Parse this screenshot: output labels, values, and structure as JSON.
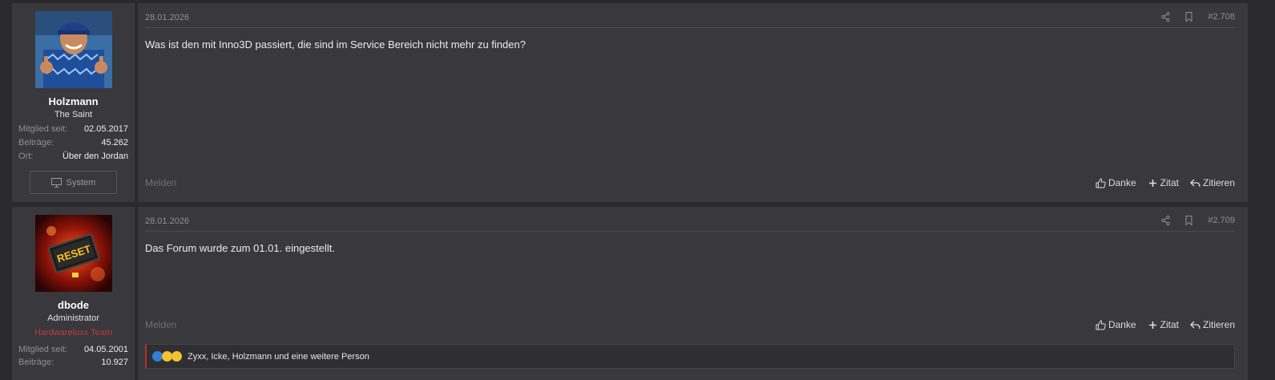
{
  "posts": [
    {
      "user": {
        "name": "Holzmann",
        "title": "The Saint",
        "banner": "",
        "stats": [
          {
            "label": "Mitglied seit:",
            "value": "02.05.2017"
          },
          {
            "label": "Beiträge:",
            "value": "45.262"
          },
          {
            "label": "Ort:",
            "value": "Über den Jordan"
          }
        ],
        "system_button": "System"
      },
      "date": "28.01.2026",
      "number": "#2.708",
      "text": "Was ist den mit Inno3D passiert, die sind im Service Bereich nicht mehr zu finden?",
      "report": "Melden",
      "actions": {
        "thanks": "Danke",
        "add_quote": "Zitat",
        "quote": "Zitieren"
      }
    },
    {
      "user": {
        "name": "dbode",
        "title": "Administrator",
        "banner": "Hardwareluxx Team",
        "stats": [
          {
            "label": "Mitglied seit:",
            "value": "04.05.2001"
          },
          {
            "label": "Beiträge:",
            "value": "10.927"
          }
        ],
        "avatar_text": "RESET"
      },
      "date": "28.01.2026",
      "number": "#2.709",
      "text": "Das Forum wurde zum 01.01. eingestellt.",
      "report": "Melden",
      "actions": {
        "thanks": "Danke",
        "add_quote": "Zitat",
        "quote": "Zitieren"
      },
      "reactions": {
        "icons": [
          "like-icon",
          "sad-icon",
          "confused-icon"
        ],
        "text": "Zyxx, Icke, Holzmann und eine weitere Person"
      }
    }
  ],
  "colors": {
    "background": "#2a2a2e",
    "panel": "#38383d",
    "banner_red": "#c33a3a",
    "muted": "#8f8f96"
  }
}
